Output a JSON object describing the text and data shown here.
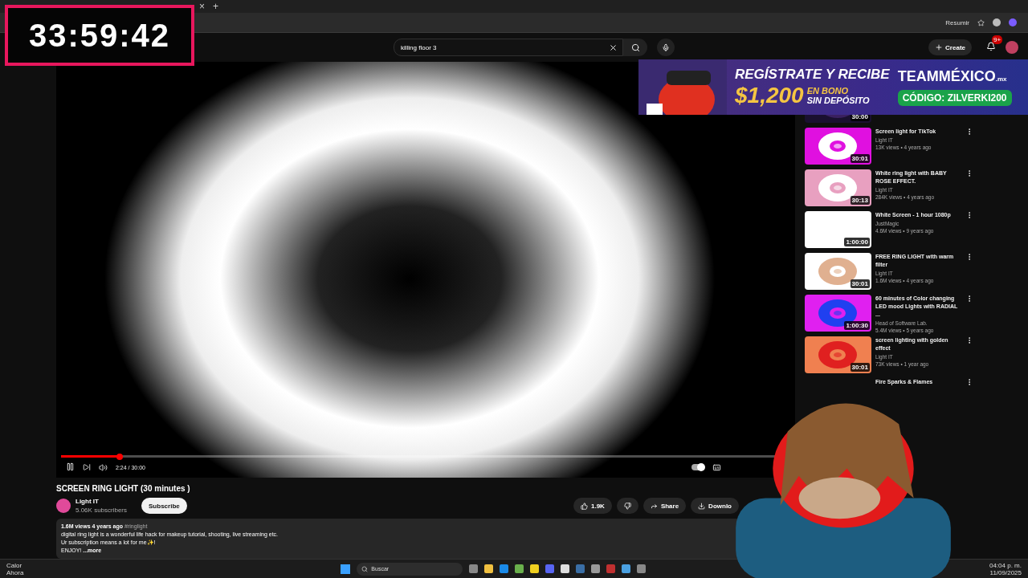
{
  "browser": {
    "tab_close": "×",
    "new_tab": "+",
    "summarize": "Resumir"
  },
  "header": {
    "search": {
      "value": "killing floor 3"
    },
    "create": "Create",
    "notifications": "9+"
  },
  "timer": {
    "text": "33:59:42"
  },
  "banner": {
    "headline": "REGÍSTRATE Y RECIBE",
    "amount": "$1,200",
    "bonus_1": "EN BONO",
    "bonus_2": "SIN DEPÓSITO",
    "brand": "TEAMMÉXICO",
    "brand_suffix": ".mx",
    "code": "CÓDIGO: ZILVERKI200"
  },
  "player": {
    "playing": true,
    "level": 0.08,
    "time": "2:24 / 30:00",
    "autoplay": true
  },
  "video": {
    "title": "SCREEN RING LIGHT (30 minutes )",
    "channel": "Light IT",
    "subscribers": "5.06K subscribers",
    "subscribe": "Subscribe",
    "likes": "1.9K",
    "share": "Share",
    "download": "Downlo",
    "description": {
      "views": "1.6M views",
      "age": "4 years ago",
      "tag": "#ringlight",
      "lines": [
        "digital ring light is a wonderful life hack for makeup tutorial, shooting, live streaming etc.",
        "Ur subscription means a lot for me✨!"
      ],
      "last": "ENJOY!",
      "more": "...more"
    }
  },
  "related": [
    {
      "duration": "30:00"
    },
    {
      "title": "Screen light for TikTok",
      "channel": "Light IT",
      "meta": "13K views • 4 years ago",
      "duration": "30:01"
    },
    {
      "title": "White ring light with BABY ROSE EFFECT.",
      "channel": "Light IT",
      "meta": "284K views • 4 years ago",
      "duration": "30:13"
    },
    {
      "title": "White Screen - 1 hour 1080p",
      "channel": "JustMagic",
      "meta": "4.6M views • 9 years ago",
      "duration": "1:00:00"
    },
    {
      "title": "FREE RING LIGHT with warm filter",
      "channel": "Light IT",
      "meta": "1.6M views • 4 years ago",
      "duration": "30:01"
    },
    {
      "title": "60 minutes of Color changing LED mood Lights with RADIAL ...",
      "channel": "Head of Software Lab.",
      "meta": "5.4M views • 5 years ago",
      "duration": "1:00:30"
    },
    {
      "title": "screen lighting with golden effect",
      "channel": "Light IT",
      "meta": "73K views • 1 year ago",
      "duration": "30:01"
    },
    {
      "title": "Fire Sparks & Flames"
    }
  ],
  "taskbar": {
    "weather": "Calor",
    "weather_sub": "Ahora",
    "search": "Buscar",
    "time": "04:04 p. m.",
    "date": "11/09/2025"
  }
}
